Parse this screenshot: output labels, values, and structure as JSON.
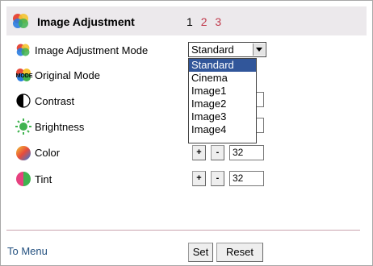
{
  "header": {
    "title": "Image Adjustment",
    "pages": [
      "1",
      "2",
      "3"
    ]
  },
  "rows": {
    "mode": {
      "label": "Image Adjustment Mode",
      "selected": "Standard"
    },
    "original": {
      "label": "Original Mode",
      "icon_text": "MODE"
    },
    "contrast": {
      "label": "Contrast"
    },
    "brightness": {
      "label": "Brightness"
    },
    "color": {
      "label": "Color",
      "value": "32"
    },
    "tint": {
      "label": "Tint",
      "value": "32"
    }
  },
  "dropdown": {
    "options": [
      "Standard",
      "Cinema",
      "Image1",
      "Image2",
      "Image3",
      "Image4"
    ],
    "highlighted": "Standard"
  },
  "stepper": {
    "plus": "+",
    "minus": "-"
  },
  "footer": {
    "menu_link": "To Menu",
    "set_label": "Set",
    "reset_label": "Reset"
  },
  "colors": {
    "page_link": "#c0394b",
    "menu_link": "#23507f",
    "highlight": "#31569a",
    "header_bg": "#ece9ec"
  },
  "icons": [
    "palette-icon",
    "mode-icon",
    "contrast-icon",
    "brightness-icon",
    "color-sphere-icon",
    "tint-icon"
  ]
}
